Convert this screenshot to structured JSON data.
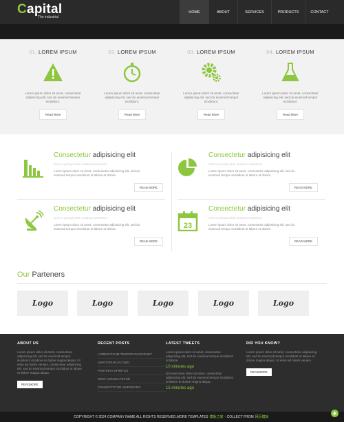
{
  "header": {
    "logo_first": "C",
    "logo_rest": "apital",
    "tagline": "The industrial",
    "nav": [
      "HOME",
      "ABOUT",
      "SERVICES",
      "PRODUCTS",
      "CONTACT"
    ],
    "active_nav": "HOME"
  },
  "features": [
    {
      "num": "01.",
      "title": "LOREM IPSUM",
      "icon": "warning-icon",
      "text": "Lorem ipsum dolor sit amet, consectetur adipisicing elit, sed do eiusmod tempor incididunt.",
      "button": "Read More"
    },
    {
      "num": "02.",
      "title": "LOREM IPSUM",
      "icon": "stopwatch-icon",
      "text": "Lorem ipsum dolor sit amet, consectetur adipisicing elit, sed do eiusmod tempor incididunt.",
      "button": "Read More"
    },
    {
      "num": "03.",
      "title": "LOREM IPSUM",
      "icon": "gears-icon",
      "text": "Lorem ipsum dolor sit amet, consectetur adipisicing elit, sed do eiusmod tempor incididunt.",
      "button": "Read More"
    },
    {
      "num": "04.",
      "title": "LOREM IPSUM",
      "icon": "flask-icon",
      "text": "Lorem ipsum dolor sit amet, consectetur adipisicing elit, sed do eiusmod tempor incididunt.",
      "button": "Read More"
    }
  ],
  "services": [
    {
      "title_green": "Consectetur",
      "title_rest": " adipisicing elit",
      "sub": "Sed ut perspiciatis undeaccusantium",
      "text": "Lorem ipsum dolor sit amet, consectetur adipisicing elit, sed do eiusmod tempor incididunt ut labore et dolore.",
      "button": "READ MORE",
      "icon": "bar-chart-icon"
    },
    {
      "title_green": "Consectetur",
      "title_rest": " adipisicing elit",
      "sub": "Sed ut perspiciatis undeaccusantium",
      "text": "Lorem ipsum dolor sit amet, consectetur adipisicing elit, sed do eiusmod tempor incididunt ut labore et dolore.",
      "button": "READ MORE",
      "icon": "pie-chart-icon"
    },
    {
      "title_green": "Consectetur",
      "title_rest": " adipisicing elit",
      "sub": "Sed ut perspiciatis undeaccusantium",
      "text": "Lorem ipsum dolor sit amet, consectetur adipisicing elit, sed do eiusmod tempor incididunt ut labore et dolore.",
      "button": "READ MORE",
      "icon": "satellite-dish-icon"
    },
    {
      "title_green": "Consectetur",
      "title_rest": " adipisicing elit",
      "sub": "Sed ut perspiciatis undeaccusantium",
      "text": "Lorem ipsum dolor sit amet, consectetur adipisicing elit, sed do eiusmod tempor incididunt ut labore et dolore.",
      "button": "READ MORE",
      "icon": "calendar-icon",
      "calendar_day": "23"
    }
  ],
  "partners": {
    "title_green": "Our",
    "title_rest": " Parteners",
    "logos": [
      "Logo",
      "Logo",
      "Logo",
      "Logo",
      "Logo"
    ]
  },
  "footer": {
    "about": {
      "heading": "ABOUT US",
      "text": "Lorem ipsum dolor sit amet, consectetur adipisicing elit, sed do eiusmod tempor incididunt ut labore et dolore magna aliqua. Ut enim ad minim veniam, consectetur adipisicing elit, sed do eiusmod tempor incididunt ut labore et dolore magna aliqua.",
      "button": "READMORE"
    },
    "posts": {
      "heading": "RECENT POSTS",
      "items": [
        "LOREM IPSUM TEMPOR INCIDIDUNT",
        "AMATORIUM EUI SED",
        "PERTINAX SPIRITUS",
        "ODIO CONSECTETUR",
        "CONSECTETUR ADIPISICING"
      ]
    },
    "tweets": {
      "heading": "LATEST TWEETS",
      "items": [
        {
          "text": "Lorem ipsum dolor sit amet, consectetur adipisicing elit, sed do eiusmod tempor incididunt ut labore",
          "time": "10 minutes ago"
        },
        {
          "text": "@consectetur dolor sit amet, consectetur adipisicing elit, sed do eiusmod tempor incididunt ut labore et dolore magna aliqua.",
          "time": "15 minutes ago"
        }
      ]
    },
    "know": {
      "heading": "DID YOU KNOW?",
      "text": "Lorem ipsum dolor sit amet, consectetur adipisicing elit, sed do eiusmod tempor incididunt ut labore et dolore magna aliqua. Ut enim ad minim veniam.",
      "button": "READMORE"
    }
  },
  "copyright": {
    "prefix": "COPYRIGHT © 2024 COMPANY NAME ALL RIGHTS RESERVED.MORE TEMPLATES",
    "link1": "模板之家",
    "middle": "- COLLECT FROM",
    "link2": "网页模板"
  },
  "colors": {
    "accent": "#8dc63f",
    "header": "#2a2a2a",
    "footer": "#2d2d2d"
  }
}
